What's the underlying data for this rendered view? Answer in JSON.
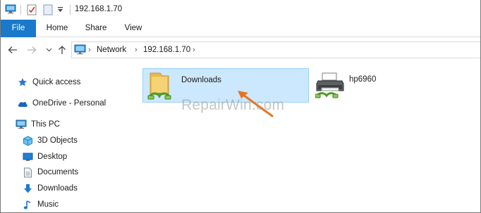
{
  "window": {
    "title": "192.168.1.70"
  },
  "ribbon": {
    "tabs": [
      {
        "label": "File"
      },
      {
        "label": "Home"
      },
      {
        "label": "Share"
      },
      {
        "label": "View"
      }
    ]
  },
  "address_bar": {
    "crumbs": [
      {
        "label": "Network"
      },
      {
        "label": "192.168.1.70"
      }
    ]
  },
  "sidebar": {
    "items": [
      {
        "label": "Quick access",
        "icon": "star-icon"
      },
      {
        "label": "OneDrive - Personal",
        "icon": "cloud-icon"
      },
      {
        "label": "This PC",
        "icon": "computer-icon"
      },
      {
        "label": "3D Objects",
        "icon": "cube-icon"
      },
      {
        "label": "Desktop",
        "icon": "desktop-icon"
      },
      {
        "label": "Documents",
        "icon": "document-icon"
      },
      {
        "label": "Downloads",
        "icon": "download-arrow-icon"
      },
      {
        "label": "Music",
        "icon": "music-note-icon"
      }
    ]
  },
  "content": {
    "items": [
      {
        "label": "Downloads",
        "icon": "shared-folder-icon",
        "selected": true
      },
      {
        "label": "hp6960",
        "icon": "printer-icon",
        "selected": false
      }
    ]
  },
  "watermark": {
    "text": "RepairWin.com"
  },
  "colors": {
    "accent": "#1979ca",
    "selection_fill": "#cce8ff",
    "selection_border": "#99d1ff",
    "annotation_arrow": "#e8741e"
  }
}
